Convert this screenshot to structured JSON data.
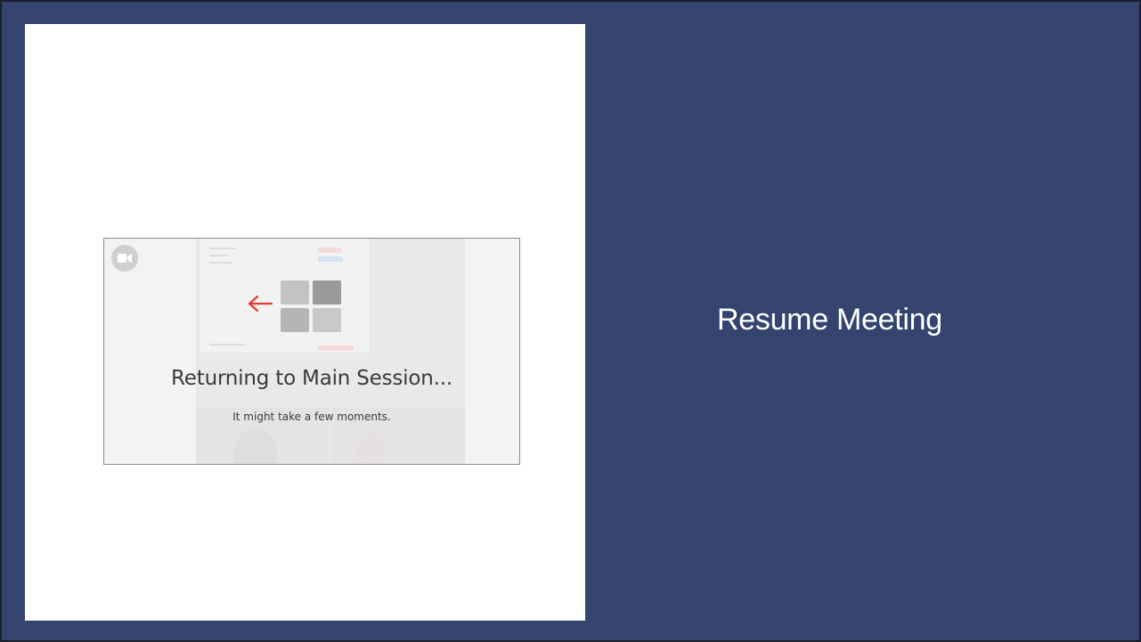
{
  "slide": {
    "title": "Resume Meeting",
    "background_color": "#34446f",
    "panel_color": "#ffffff"
  },
  "zoom_window": {
    "heading": "Returning to Main Session...",
    "subtext": "It might take a few moments.",
    "icons": {
      "camera": "video-camera-icon",
      "arrow": "arrow-left-icon",
      "tiles": "breakout-rooms-grid-icon"
    },
    "arrow_color": "#e53935"
  }
}
